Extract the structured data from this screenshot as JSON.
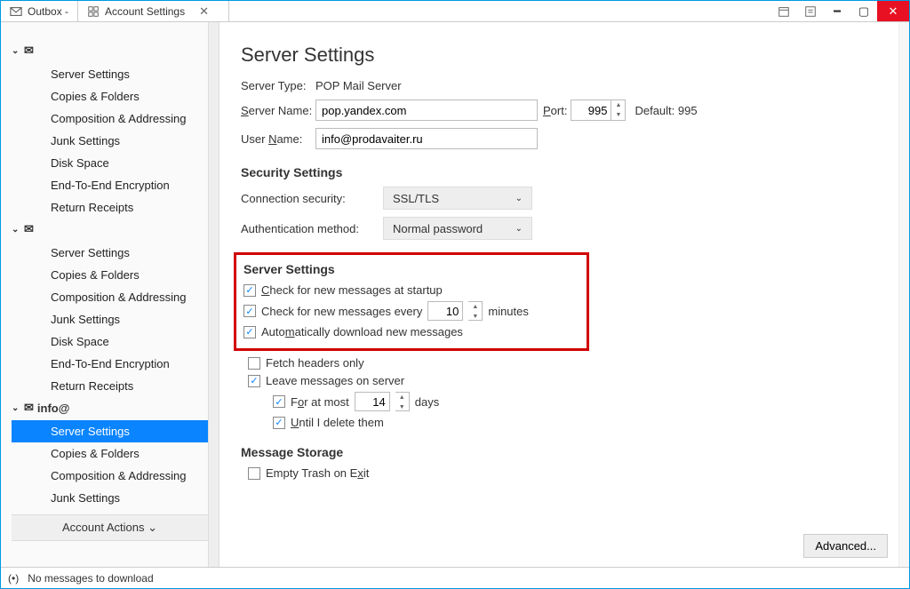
{
  "tabs": {
    "outbox": "Outbox -",
    "account_settings": "Account Settings"
  },
  "sidebar": {
    "accounts": [
      {
        "name": "",
        "items": [
          "Server Settings",
          "Copies & Folders",
          "Composition & Addressing",
          "Junk Settings",
          "Disk Space",
          "End-To-End Encryption",
          "Return Receipts"
        ]
      },
      {
        "name": "",
        "items": [
          "Server Settings",
          "Copies & Folders",
          "Composition & Addressing",
          "Junk Settings",
          "Disk Space",
          "End-To-End Encryption",
          "Return Receipts"
        ]
      },
      {
        "name": "info@",
        "items": [
          "Server Settings",
          "Copies & Folders",
          "Composition & Addressing",
          "Junk Settings"
        ]
      }
    ],
    "account_actions": "Account Actions"
  },
  "page": {
    "title": "Server Settings",
    "server_type_label": "Server Type:",
    "server_type_value": "POP Mail Server",
    "server_name_label": "Server Name:",
    "server_name_value": "pop.yandex.com",
    "port_label": "Port:",
    "port_value": "995",
    "default_port": "Default: 995",
    "user_name_label": "User Name:",
    "user_name_value": "info@prodavaiter.ru"
  },
  "security": {
    "title": "Security Settings",
    "conn_label": "Connection security:",
    "conn_value": "SSL/TLS",
    "auth_label": "Authentication method:",
    "auth_value": "Normal password"
  },
  "server_settings": {
    "title": "Server Settings",
    "check_startup": "Check for new messages at startup",
    "check_every_pre": "Check for new messages every",
    "check_every_value": "10",
    "check_every_post": "minutes",
    "auto_download": "Automatically download new messages",
    "fetch_headers": "Fetch headers only",
    "leave_on_server": "Leave messages on server",
    "for_at_most_pre": "For at most",
    "for_at_most_value": "14",
    "for_at_most_post": "days",
    "until_delete": "Until I delete them"
  },
  "storage": {
    "title": "Message Storage",
    "empty_trash": "Empty Trash on Exit"
  },
  "advanced_btn": "Advanced...",
  "status": {
    "text": "No messages to download"
  }
}
